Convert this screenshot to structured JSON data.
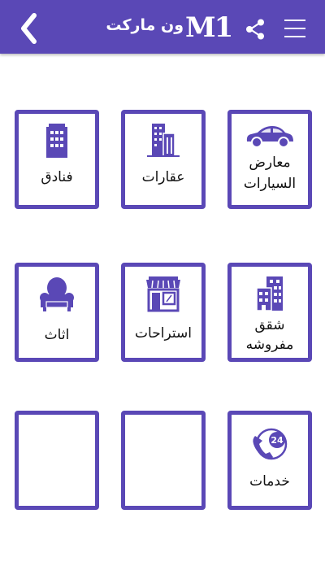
{
  "header": {
    "brand_logo": "M1",
    "brand_name": "ون ماركت",
    "color": "#5a48b6"
  },
  "tiles": [
    {
      "line1": "معارض",
      "line2": "السيارات",
      "icon": "car-icon"
    },
    {
      "line1": "عقارات",
      "line2": "",
      "icon": "buildings-icon"
    },
    {
      "line1": "فنادق",
      "line2": "",
      "icon": "hotel-icon"
    },
    {
      "line1": "شقق",
      "line2": "مفروشه",
      "icon": "apartment-icon"
    },
    {
      "line1": "استراحات",
      "line2": "",
      "icon": "shop-icon"
    },
    {
      "line1": "اثاث",
      "line2": "",
      "icon": "armchair-icon"
    },
    {
      "line1": "خدمات",
      "line2": "",
      "icon": "24h-service-icon"
    },
    {
      "line1": "",
      "line2": "",
      "icon": ""
    },
    {
      "line1": "",
      "line2": "",
      "icon": ""
    }
  ]
}
